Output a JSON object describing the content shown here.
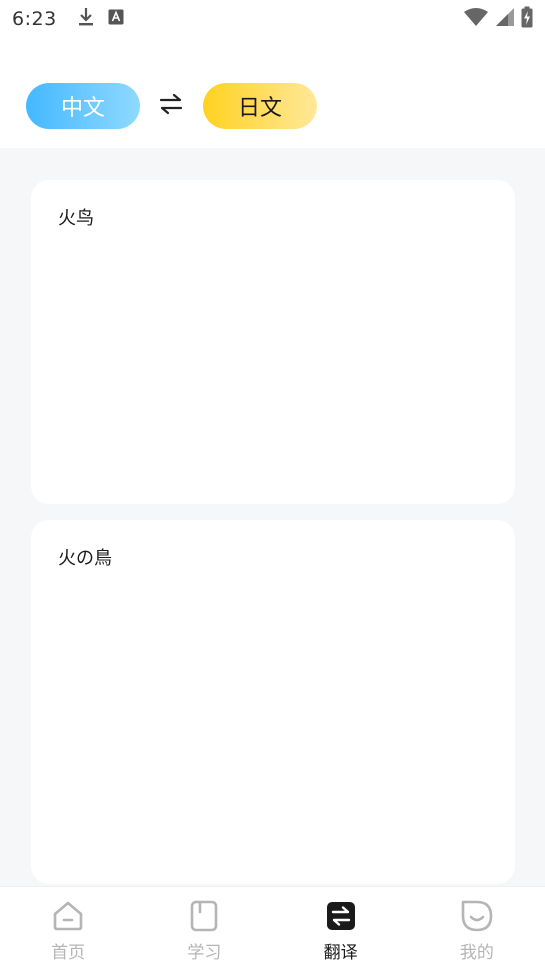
{
  "status_bar": {
    "time": "6:23",
    "icons": [
      "download-icon",
      "keyboard-a-icon",
      "wifi-icon",
      "signal-icon",
      "battery-charging-icon"
    ]
  },
  "language": {
    "source": "中文",
    "target": "日文",
    "swap_icon": "swap-arrows-icon"
  },
  "input": {
    "text": "火鸟"
  },
  "output": {
    "text": "火の鳥"
  },
  "nav": {
    "active": "翻译",
    "items": [
      {
        "label": "首页",
        "icon": "home-icon"
      },
      {
        "label": "学习",
        "icon": "book-icon"
      },
      {
        "label": "翻译",
        "icon": "translate-icon"
      },
      {
        "label": "我的",
        "icon": "profile-icon"
      }
    ]
  },
  "colors": {
    "source_pill": "#44b8ff",
    "target_pill": "#ffd21f",
    "nav_inactive": "#b5b5b5",
    "nav_active": "#1a1a1a"
  }
}
